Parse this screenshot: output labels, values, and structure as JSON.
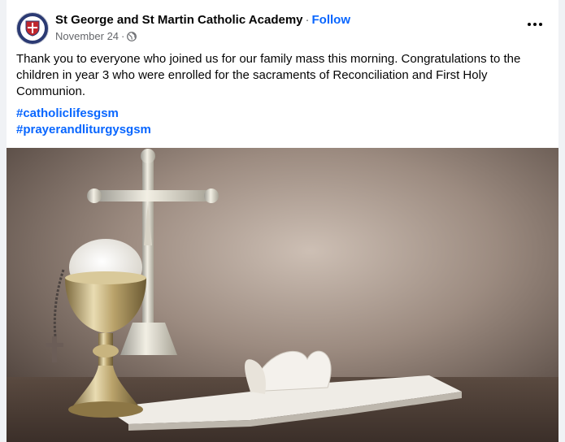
{
  "post": {
    "page_name": "St George and St Martin Catholic Academy",
    "separator": "·",
    "follow_label": "Follow",
    "date": "November 24",
    "date_separator": "·",
    "privacy_icon": "globe-icon",
    "more_icon": "more-options-icon",
    "body_text": "Thank you to everyone who joined us for our family mass this morning. Congratulations to the children in year 3 who were enrolled for the sacraments of Reconciliation and First Holy Communion.",
    "hashtags": [
      "#catholiclifesgsm",
      "#prayerandliturgysgsm"
    ],
    "image_subject": "chalice-crucifix-open-bible"
  },
  "colors": {
    "link": "#0866ff",
    "text": "#050505",
    "secondary_text": "#65676b",
    "background": "#f0f2f5",
    "avatar_bg": "#2b3a73"
  }
}
